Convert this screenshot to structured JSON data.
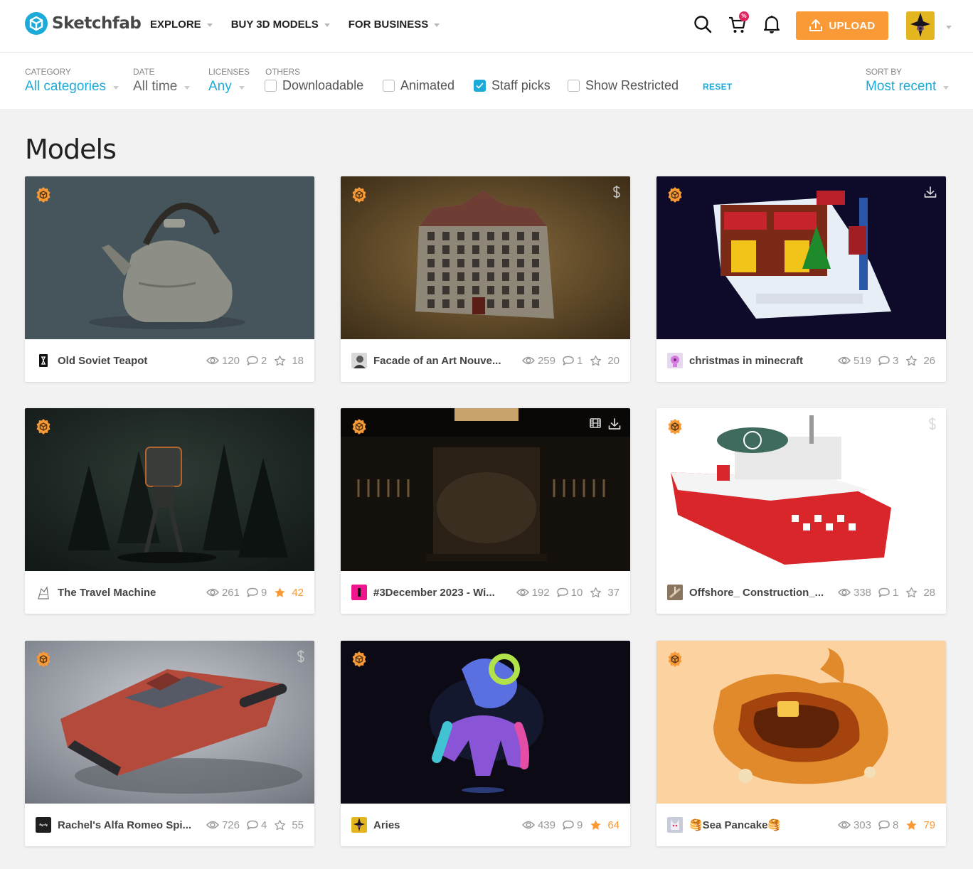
{
  "brand": {
    "name": "Sketchfab",
    "accent": "#1caad9",
    "upload_color": "#fa9a37"
  },
  "nav": [
    {
      "label": "EXPLORE"
    },
    {
      "label": "BUY 3D MODELS"
    },
    {
      "label": "FOR BUSINESS"
    }
  ],
  "header": {
    "icons": [
      "search-icon",
      "cart-icon",
      "bell-icon"
    ],
    "cart_badge": "%",
    "upload_label": "UPLOAD"
  },
  "filters": {
    "category": {
      "label": "CATEGORY",
      "value": "All categories"
    },
    "date": {
      "label": "DATE",
      "value": "All time"
    },
    "licenses": {
      "label": "LICENSES",
      "value": "Any"
    },
    "others": {
      "label": "OTHERS",
      "options": [
        {
          "label": "Downloadable",
          "checked": false
        },
        {
          "label": "Animated",
          "checked": false
        },
        {
          "label": "Staff picks",
          "checked": true
        },
        {
          "label": "Show Restricted",
          "checked": false
        }
      ]
    },
    "reset_label": "RESET",
    "sort": {
      "label": "SORT BY",
      "value": "Most recent"
    }
  },
  "page_title": "Models",
  "models": [
    {
      "title": "Old Soviet Teapot",
      "views": "120",
      "comments": "2",
      "likes": "18",
      "liked": false,
      "staff_pick": true,
      "corner_icons": []
    },
    {
      "title": "Facade of an Art Nouve...",
      "views": "259",
      "comments": "1",
      "likes": "20",
      "liked": false,
      "staff_pick": true,
      "corner_icons": [
        "price-icon"
      ]
    },
    {
      "title": "christmas in minecraft",
      "views": "519",
      "comments": "3",
      "likes": "26",
      "liked": false,
      "staff_pick": true,
      "corner_icons": [
        "download-icon"
      ]
    },
    {
      "title": "The Travel Machine",
      "views": "261",
      "comments": "9",
      "likes": "42",
      "liked": true,
      "staff_pick": true,
      "corner_icons": []
    },
    {
      "title": "#3December 2023 - Wi...",
      "views": "192",
      "comments": "10",
      "likes": "37",
      "liked": false,
      "staff_pick": true,
      "corner_icons": [
        "animated-icon",
        "download-icon"
      ]
    },
    {
      "title": "Offshore_ Construction_...",
      "views": "338",
      "comments": "1",
      "likes": "28",
      "liked": false,
      "staff_pick": true,
      "corner_icons": [
        "price-icon"
      ]
    },
    {
      "title": "Rachel's Alfa Romeo Spi...",
      "views": "726",
      "comments": "4",
      "likes": "55",
      "liked": false,
      "staff_pick": true,
      "corner_icons": [
        "price-icon"
      ]
    },
    {
      "title": "Aries",
      "views": "439",
      "comments": "9",
      "likes": "64",
      "liked": true,
      "staff_pick": true,
      "corner_icons": []
    },
    {
      "title": "🥞Sea Pancake🥞",
      "views": "303",
      "comments": "8",
      "likes": "79",
      "liked": true,
      "staff_pick": true,
      "corner_icons": []
    }
  ]
}
